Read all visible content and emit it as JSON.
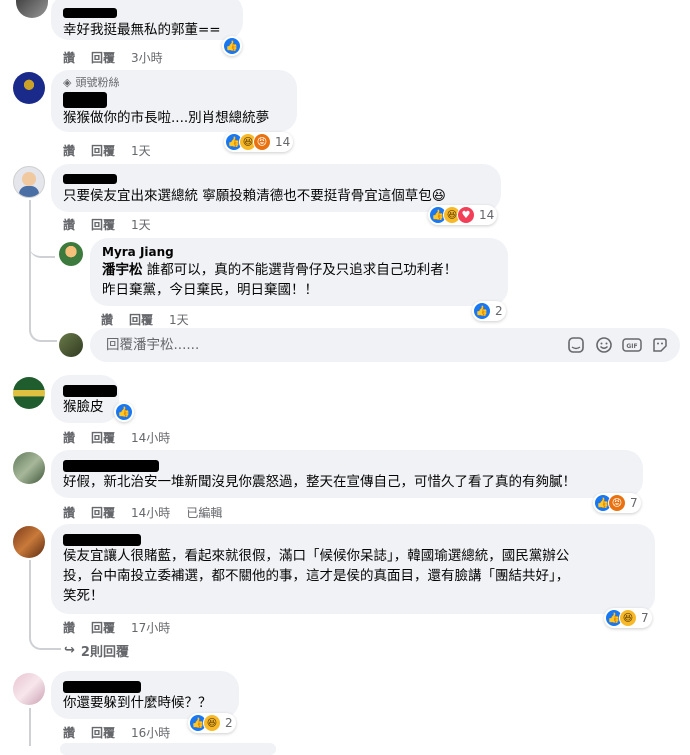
{
  "comments": [
    {
      "text": "幸好我挺最無私的郭董==",
      "actions": {
        "like": "讚",
        "reply": "回覆",
        "time": "3小時"
      }
    },
    {
      "badge": "頭號粉絲",
      "text": "猴猴做你的市長啦....別肖想總統夢",
      "actions": {
        "like": "讚",
        "reply": "回覆",
        "time": "1天"
      },
      "reaction_count": "14"
    },
    {
      "text": "只要侯友宜出來選總統 寧願投賴清德也不要挺背骨宜這個草包😆",
      "actions": {
        "like": "讚",
        "reply": "回覆",
        "time": "1天"
      },
      "reaction_count": "14",
      "reply": {
        "name": "Myra Jiang",
        "mention": "潘宇松",
        "text_lines": [
          " 誰都可以，真的不能選背骨仔及只追求自己功利者！",
          "昨日棄黨，今日棄民，明日棄國！！"
        ],
        "actions": {
          "like": "讚",
          "reply": "回覆",
          "time": "1天"
        },
        "reaction_count": "2"
      },
      "reply_box": {
        "placeholder": "回覆潘宇松......"
      }
    },
    {
      "text": "猴臉皮",
      "actions": {
        "like": "讚",
        "reply": "回覆",
        "time": "14小時"
      }
    },
    {
      "text": "好假，新北治安一堆新聞沒見你震怒過，整天在宣傳自己，可惜久了看了真的有夠膩！",
      "actions": {
        "like": "讚",
        "reply": "回覆",
        "time": "14小時",
        "edited": "已編輯"
      },
      "reaction_count": "7"
    },
    {
      "text_lines": [
        "侯友宜讓人很賭藍，看起來就很假，滿口「候候你呆誌」，韓國瑜選總統，國民黨辦公",
        "投，台中南投立委補選，都不關他的事，這才是侯的真面目，還有臉講「團結共好」，",
        "笑死！"
      ],
      "actions": {
        "like": "讚",
        "reply": "回覆",
        "time": "17小時"
      },
      "reaction_count": "7",
      "more_replies": "2則回覆"
    },
    {
      "text": "你還要躲到什麼時候？？",
      "actions": {
        "like": "讚",
        "reply": "回覆",
        "time": "16小時"
      },
      "reaction_count": "2"
    }
  ],
  "colors": {
    "like": "#1877f2",
    "haha": "#f7b928",
    "angry": "#e9710f",
    "love": "#f33e58",
    "bubble": "#f0f2f5",
    "meta": "#65676b"
  },
  "icons": [
    "like-icon",
    "haha-icon",
    "angry-icon",
    "love-icon",
    "sticker-icon",
    "emoji-icon",
    "gif-icon",
    "photo-sticker-icon",
    "reply-arrow-icon",
    "fan-badge-icon"
  ]
}
